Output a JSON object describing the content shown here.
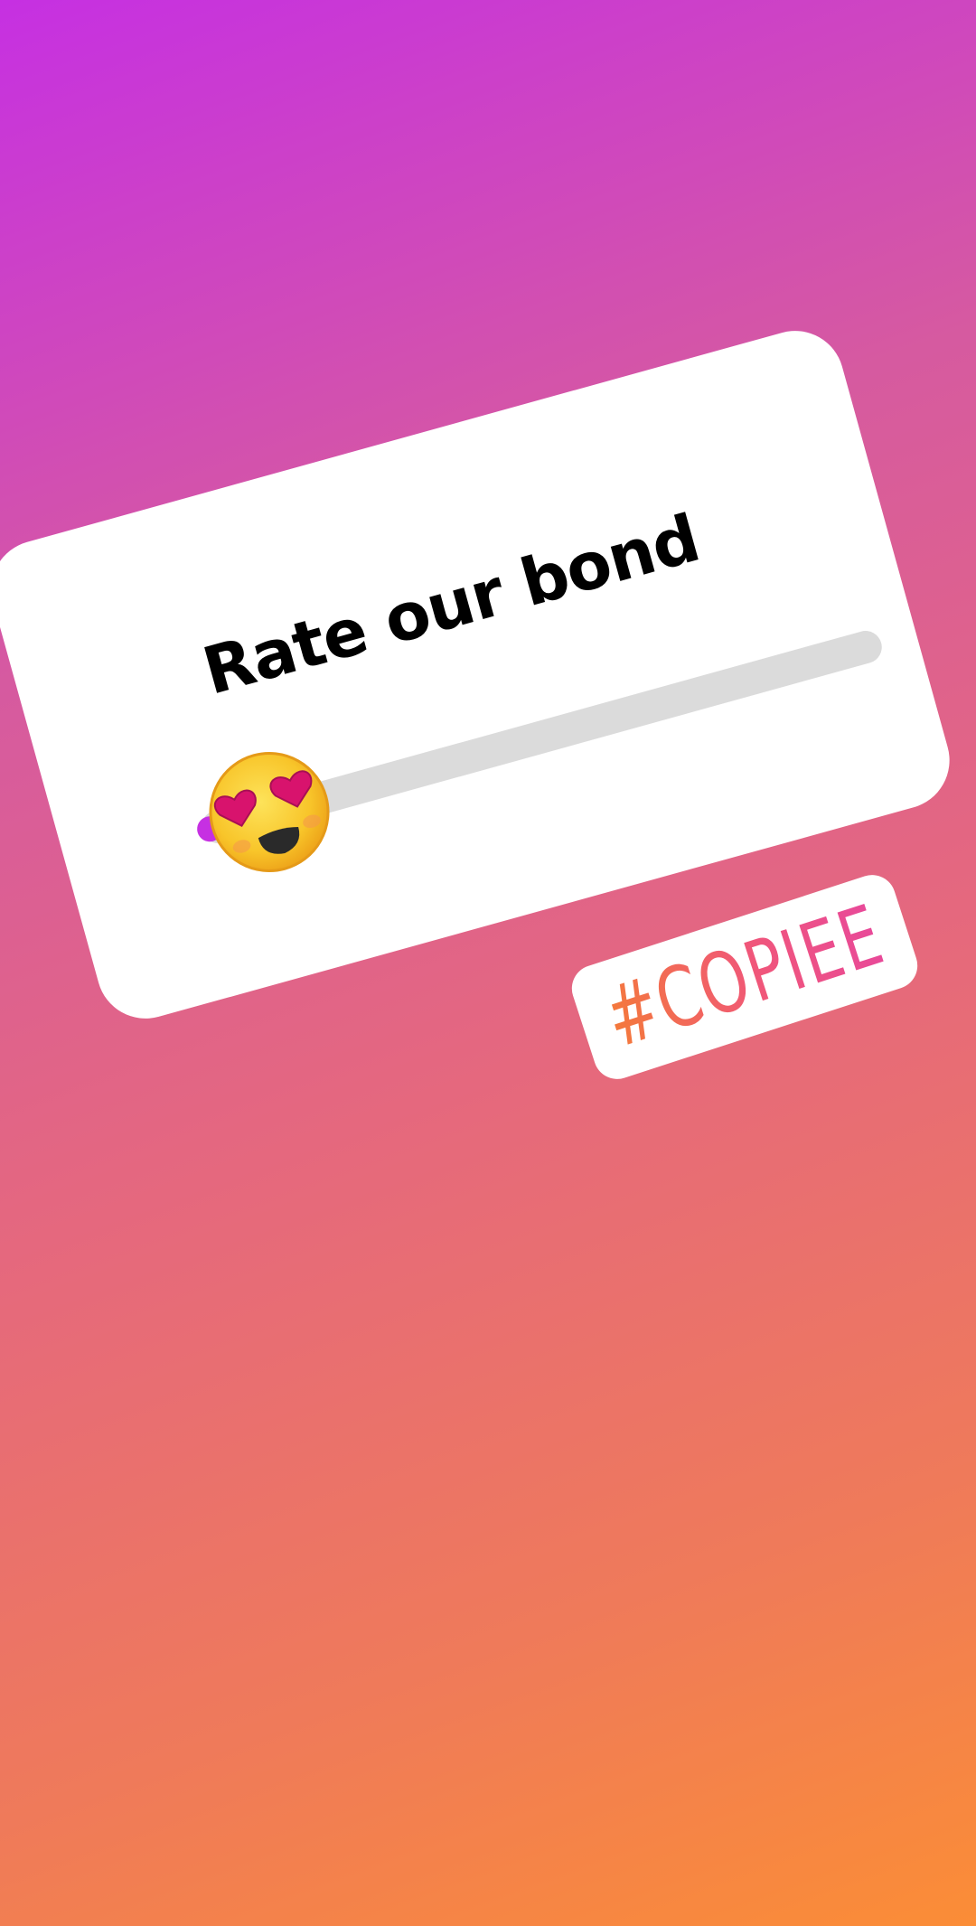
{
  "background": {
    "gradient_start": "#c630e2",
    "gradient_end": "#fb8d36"
  },
  "slider_sticker": {
    "question": "Rate our bond",
    "emoji": "smiling-face-with-heart-eyes",
    "value_fraction": 0.0,
    "track_color": "#dbdbdb",
    "fill_color": "#c630e2"
  },
  "hashtag_sticker": {
    "text": "#COPIEE",
    "gradient_start": "#f47a3a",
    "gradient_end": "#e8499a"
  }
}
